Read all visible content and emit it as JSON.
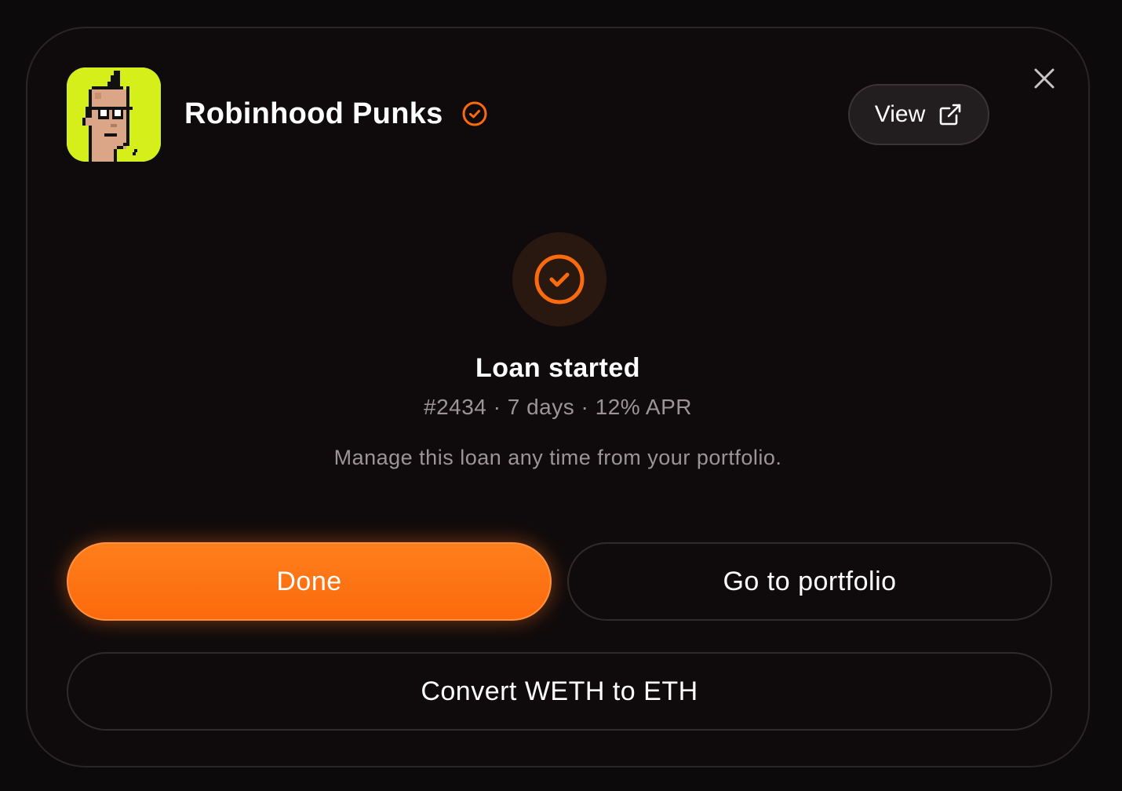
{
  "collection": {
    "name": "Robinhood Punks",
    "verified": true,
    "avatar_bg": "#d4ef1a",
    "avatar_icon": "pixel-punk-avatar"
  },
  "header": {
    "view_label": "View",
    "view_icon": "external-link-icon",
    "close_icon": "close-icon"
  },
  "status": {
    "icon": "check-circle-icon",
    "title": "Loan started",
    "meta": "#2434 · 7 days · 12% APR",
    "note": "Manage this loan any time from your portfolio."
  },
  "actions": {
    "done_label": "Done",
    "portfolio_label": "Go to portfolio",
    "convert_label": "Convert WETH to ETH"
  },
  "colors": {
    "accent": "#fb6a0c",
    "background": "#0f0b0c",
    "muted_text": "#9b9597"
  }
}
